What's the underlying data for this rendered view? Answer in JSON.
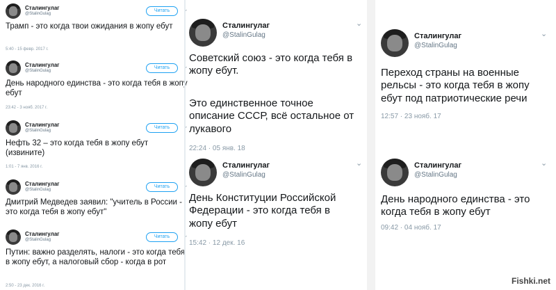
{
  "common": {
    "name": "Сталингулаг",
    "handle": "@StalinGulag",
    "follow_label": "Читать"
  },
  "left_tweets": [
    {
      "text": "Трамп - это когда твои ожидания в жопу ебут",
      "date": "5:40 - 15 февр. 2017 г."
    },
    {
      "text": "День народного единства - это когда тебя в жопу ебут",
      "date": "23:42 - 3 нояб. 2017 г."
    },
    {
      "text": "Нефть 32 – это когда тебя в жопу ебут (извините)",
      "date": "1:01 - 7 янв. 2016 г."
    },
    {
      "text": "Дмитрий Медведев заявил: \"учитель в России - это когда тебя в жопу ебут\"",
      "date": ""
    },
    {
      "text": "Путин: важно разделять, налоги - это когда тебя в жопу ебут, а налоговый сбор - когда в рот",
      "date": "2:50 - 23 дек. 2016 г."
    }
  ],
  "mid_tweets": [
    {
      "text": "Советский союз - это когда тебя в жопу ебут.",
      "text2": "Это единственное точное описание СССР, всё остальное от лукавого",
      "date": "22:24 · 05 янв. 18"
    },
    {
      "text": "День Конституции Российской Федерации - это когда тебя в жопу ебут",
      "date": "15:42 · 12 дек. 16"
    }
  ],
  "right_tweets": [
    {
      "text": "Переход страны на военные рельсы - это когда тебя в жопу ебут под патриотические речи",
      "date": "12:57 · 23 нояб. 17"
    },
    {
      "text": "День народного единства - это когда тебя в жопу ебут",
      "date": "09:42 · 04 нояб. 17"
    }
  ],
  "watermark": "Fishki.net"
}
